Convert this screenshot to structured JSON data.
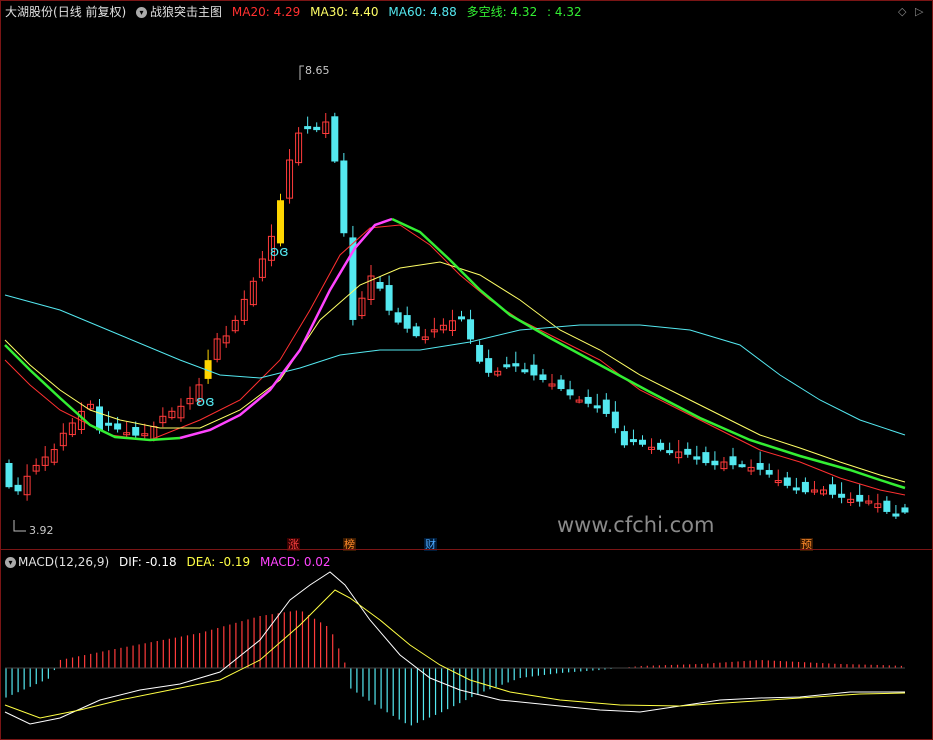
{
  "window": {
    "stock_name": "大湖股份",
    "period": "(日线 前复权)",
    "indicator_name": "战狼突击主图"
  },
  "main_legend": [
    {
      "label": "MA20: 4.29",
      "color": "#ff3030"
    },
    {
      "label": "MA30: 4.40",
      "color": "#ffff66"
    },
    {
      "label": "MA60: 4.88",
      "color": "#54e8f0"
    },
    {
      "label": "多空线: 4.32",
      "color": "#33ee33"
    },
    {
      "label": ": 4.32",
      "color": "#33ee33"
    }
  ],
  "price_labels": {
    "high": "8.65",
    "low": "3.92"
  },
  "event_markers": [
    {
      "text": "涨",
      "style": "red"
    },
    {
      "text": "榜",
      "style": "orange"
    },
    {
      "text": "财",
      "style": "blue"
    },
    {
      "text": "预",
      "style": "orange"
    }
  ],
  "watermark": "www.cfchi.com",
  "macd": {
    "name": "MACD(12,26,9)",
    "dif": "DIF: -0.18",
    "dea": "DEA: -0.19",
    "macd": "MACD: 0.02"
  },
  "colors": {
    "up": "#ff3b3b",
    "down": "#54e8f0",
    "highlight": "#ffd600",
    "dif": "#ffffff",
    "dea": "#ffff44"
  }
}
